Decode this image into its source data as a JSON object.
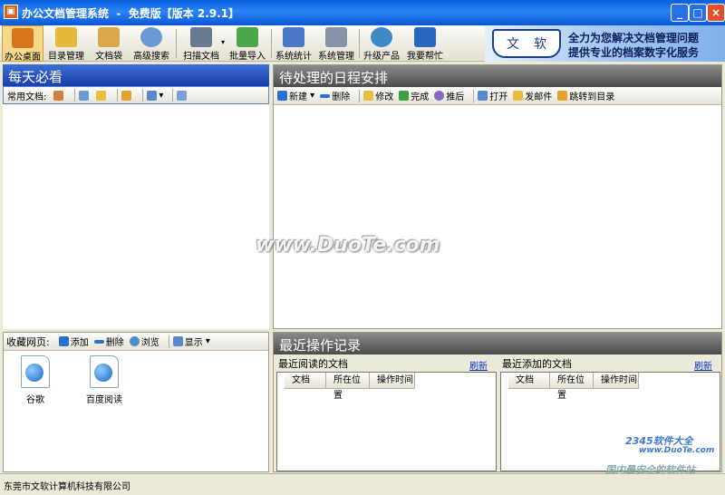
{
  "window": {
    "title": "办公文档管理系统  -  免费版【版本 2.9.1】",
    "controls": {
      "minimize": "_",
      "maximize": "□",
      "close": "×"
    }
  },
  "toolbar": [
    {
      "label": "办公桌面",
      "icon": "house-icon",
      "color": "#d9741e"
    },
    {
      "label": "目录管理",
      "icon": "folder-icon",
      "color": "#e8b83a"
    },
    {
      "label": "文档袋",
      "icon": "document-bag-icon",
      "color": "#d8a94a"
    },
    {
      "label": "高级搜索",
      "icon": "magnifier-icon",
      "color": "#6b9bd6"
    },
    {
      "label": "扫描文档",
      "icon": "scanner-icon",
      "color": "#6a7b90"
    },
    {
      "label": "批量导入",
      "icon": "import-arrow-icon",
      "color": "#4aa84a"
    },
    {
      "label": "系统统计",
      "icon": "bar-chart-icon",
      "color": "#4a78c8"
    },
    {
      "label": "系统管理",
      "icon": "user-card-icon",
      "color": "#8a94a8"
    },
    {
      "label": "升级产品",
      "icon": "globe-network-icon",
      "color": "#3c8ac8"
    },
    {
      "label": "我要帮忙",
      "icon": "help-person-icon",
      "color": "#2a68c0"
    }
  ],
  "banner": {
    "logo_char1": "文",
    "logo_char2": "软",
    "slogan_line1": "全力为您解决文档管理问题",
    "slogan_line2": "提供专业的档案数字化服务"
  },
  "left_top": {
    "title": "每天必看",
    "common_docs_label": "常用文档:"
  },
  "left_bottom": {
    "fav_label": "收藏网页:",
    "add": "添加",
    "delete": "删除",
    "browse": "浏览",
    "display": "显示",
    "favorites": [
      {
        "label": "谷歌",
        "icon": "web-page-globe-icon"
      },
      {
        "label": "百度阅读",
        "icon": "web-page-globe-icon"
      }
    ]
  },
  "schedule": {
    "title": "待处理的日程安排",
    "actions": [
      {
        "label": "新建",
        "icon": "plus-icon",
        "color": "#2a70d0"
      },
      {
        "label": "删除",
        "icon": "minus-icon",
        "color": "#2a70d0"
      },
      {
        "label": "修改",
        "icon": "edit-icon",
        "color": "#e8c040"
      },
      {
        "label": "完成",
        "icon": "check-icon",
        "color": "#3aa040"
      },
      {
        "label": "推后",
        "icon": "clock-icon",
        "color": "#8a68c0"
      },
      {
        "label": "打开",
        "icon": "open-doc-icon",
        "color": "#5a88d0"
      },
      {
        "label": "发邮件",
        "icon": "envelope-icon",
        "color": "#e8c040"
      },
      {
        "label": "跳转到目录",
        "icon": "folder-jump-icon",
        "color": "#e8a030"
      }
    ]
  },
  "recent": {
    "title": "最近操作记录",
    "read_title": "最近阅读的文档",
    "added_title": "最近添加的文档",
    "refresh": "刷新",
    "columns": [
      "文档",
      "所在位置",
      "操作时间"
    ]
  },
  "status": {
    "company": "东莞市文软计算机科技有限公司"
  },
  "watermark": {
    "main": "www.DuoTe.com",
    "corner1": "2345软件大全",
    "corner2": "www.DuoTe.com",
    "corner3": "国内最安全的软件站"
  }
}
